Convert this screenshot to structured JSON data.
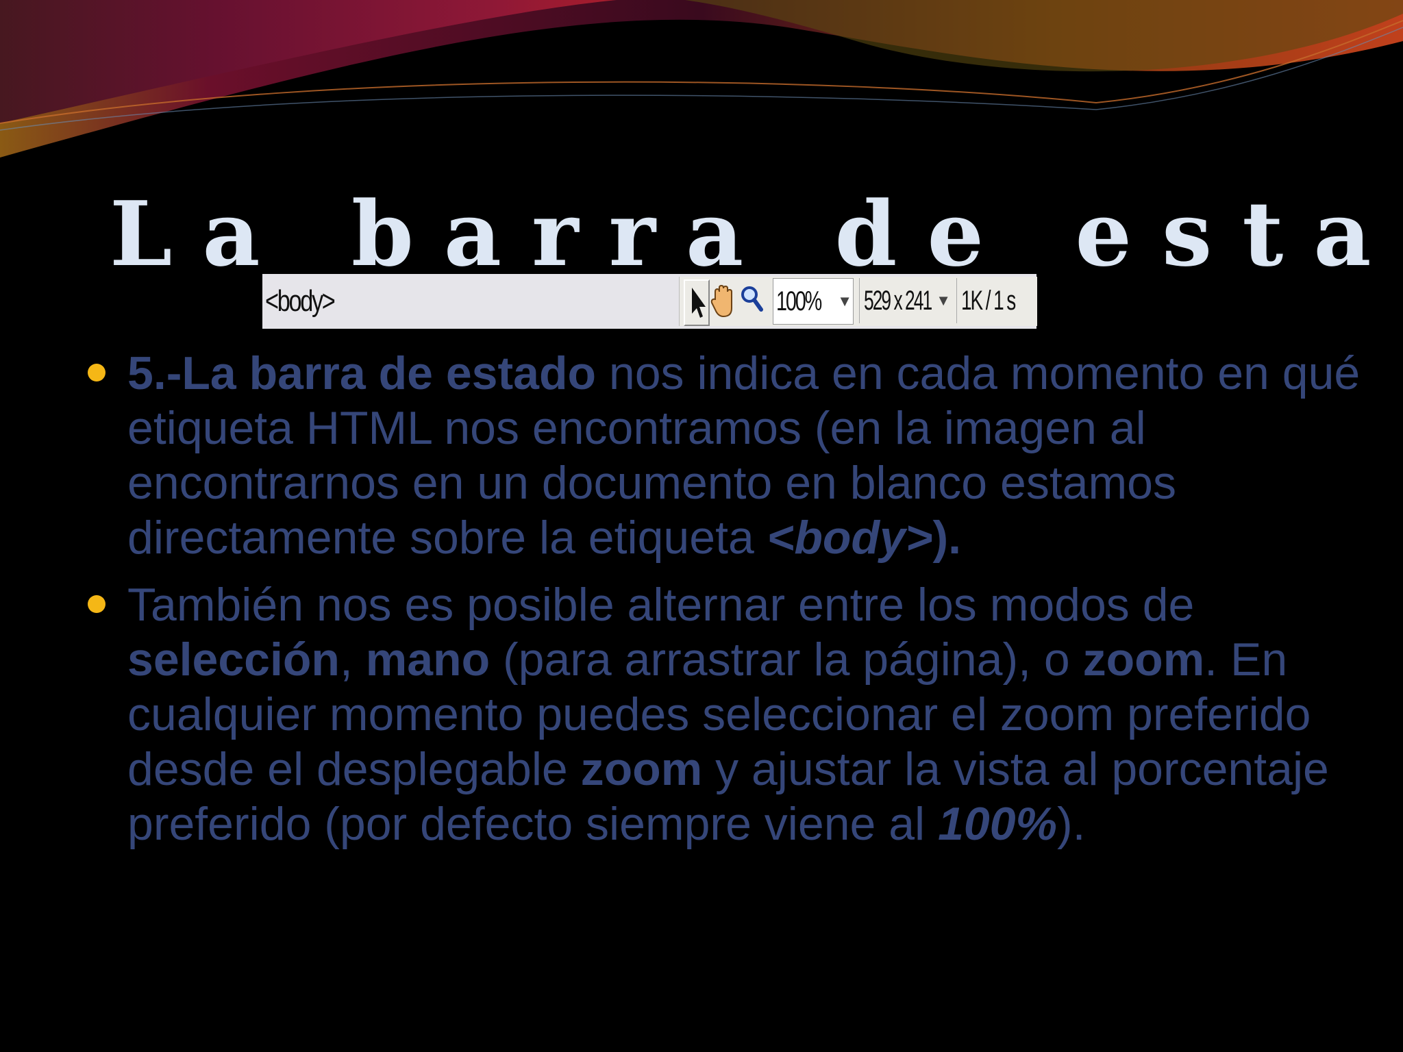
{
  "slide": {
    "title": "La barra de estado",
    "colors": {
      "background": "#000000",
      "title": "#dde7f4",
      "text": "#354679",
      "bullet": "#f5b716"
    }
  },
  "statusbar": {
    "tag": "<body>",
    "tools": [
      "pointer-icon",
      "hand-icon",
      "magnifier-icon"
    ],
    "zoom": "100%",
    "size": "529 x 241",
    "speed": "1K / 1 s"
  },
  "bullets": [
    {
      "p1_b": "5.-La barra de estado",
      "p2": " nos indica en cada momento en qué etiqueta HTML nos encontramos (en la imagen al encontrarnos en un documento en blanco estamos directamente sobre la etiqueta ",
      "p3_bi": "<body>",
      "p4_b": ")."
    },
    {
      "p1": "También nos es posible alternar entre los modos de ",
      "p2_b": "selección",
      "p3": ", ",
      "p4_b": "mano",
      "p5": " (para arrastrar la página), o ",
      "p6_b": "zoom",
      "p7": ". En cualquier momento puedes seleccionar el zoom preferido desde el desplegable ",
      "p8_b": "zoom",
      "p9": " y ajustar la vista al porcentaje preferido (por defecto siempre viene al ",
      "p10_bi": "100%",
      "p11": ")."
    }
  ]
}
